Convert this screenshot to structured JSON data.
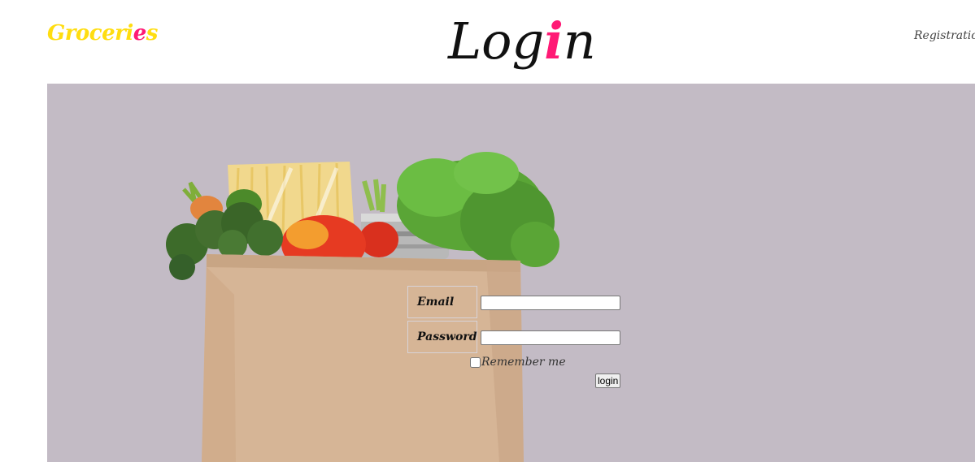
{
  "header": {
    "brand_main": "Groceri",
    "brand_accent": "e",
    "brand_end": "s",
    "title_start": "Log",
    "title_accent": "i",
    "title_end": "n",
    "nav_link": "Registration"
  },
  "form": {
    "email_label": "Email",
    "email_value": "",
    "password_label": "Password",
    "password_value": "",
    "remember_label": "Remember me",
    "remember_checked": false,
    "submit_label": "login"
  },
  "hero": {
    "image_subject": "paper grocery bag with vegetables"
  },
  "colors": {
    "brand_yellow": "#ffdd10",
    "accent_pink": "#ff1a75",
    "hero_background": "#c3bbc5"
  }
}
